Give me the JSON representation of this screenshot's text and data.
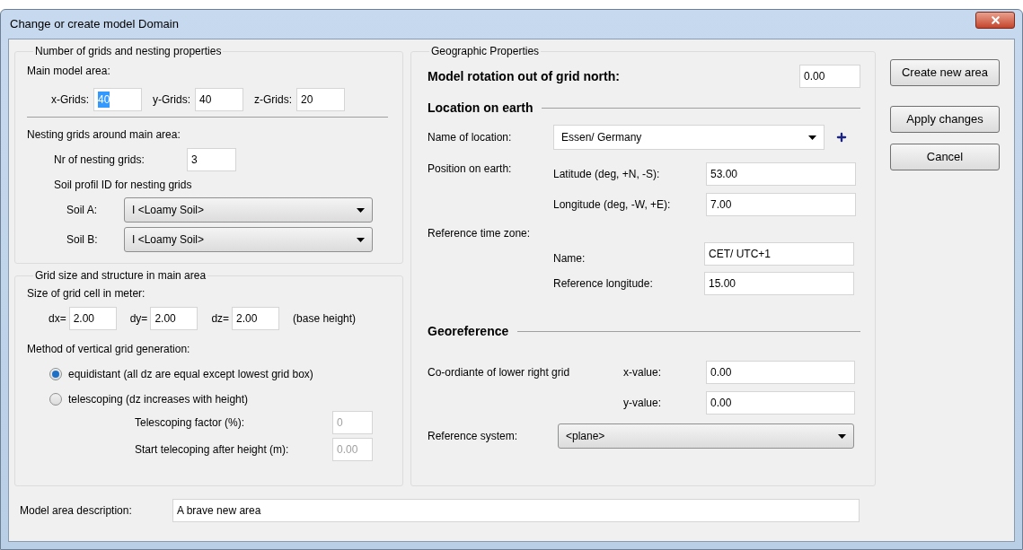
{
  "window": {
    "title": "Change or create model Domain"
  },
  "grids_group": {
    "title": "Number of grids and nesting properties",
    "main_area_label": "Main model area:",
    "grid_fields": [
      {
        "label": "x-Grids:",
        "value": "40",
        "selected": true
      },
      {
        "label": "y-Grids:",
        "value": "40",
        "selected": false
      },
      {
        "label": "z-Grids:",
        "value": "20",
        "selected": false
      }
    ],
    "nesting_label": "Nesting grids around main area:",
    "nesting_count": {
      "label": "Nr of nesting grids:",
      "value": "3"
    },
    "soil_label": "Soil profil ID for nesting grids",
    "soils": [
      {
        "label": "Soil A:",
        "value": "I <Loamy Soil>"
      },
      {
        "label": "Soil B:",
        "value": "I <Loamy Soil>"
      }
    ]
  },
  "structure_group": {
    "title": "Grid size and structure in main area",
    "cell_size_label": "Size of grid cell in meter:",
    "cell_fields": [
      {
        "label": "dx=",
        "value": "2.00"
      },
      {
        "label": "dy=",
        "value": "2.00"
      },
      {
        "label": "dz=",
        "value": "2.00"
      }
    ],
    "cell_note": "(base height)",
    "method_label": "Method of vertical grid generation:",
    "methods": [
      {
        "label": "equidistant (all dz are equal except lowest grid box)",
        "selected": true
      },
      {
        "label": "telescoping (dz increases with height)",
        "selected": false
      }
    ],
    "telescoping_fields": [
      {
        "label": "Telescoping factor (%):",
        "value": "0",
        "disabled": true
      },
      {
        "label": "Start telecoping after height (m):",
        "value": "0.00",
        "disabled": true
      }
    ]
  },
  "geo_group": {
    "title": "Geographic Properties",
    "rotation": {
      "label": "Model rotation out of grid north:",
      "value": "0.00"
    },
    "location_heading": "Location on earth",
    "location": {
      "label": "Name of location:",
      "value": "Essen/ Germany"
    },
    "position_label": "Position on earth:",
    "position_fields": [
      {
        "label": "Latitude (deg, +N, -S):",
        "value": "53.00"
      },
      {
        "label": "Longitude (deg, -W, +E):",
        "value": "7.00"
      }
    ],
    "timezone_label": "Reference time zone:",
    "timezone_fields": [
      {
        "label": "Name:",
        "value": "CET/ UTC+1"
      },
      {
        "label": "Reference longitude:",
        "value": "15.00"
      }
    ],
    "georeference_heading": "Georeference",
    "coordinate_label": "Co-ordiante of lower right grid",
    "coordinate_fields": [
      {
        "label": "x-value:",
        "value": "0.00"
      },
      {
        "label": "y-value:",
        "value": "0.00"
      }
    ],
    "reference_system": {
      "label": "Reference system:",
      "value": "<plane>"
    }
  },
  "buttons": [
    "Create new area",
    "Apply changes",
    "Cancel"
  ],
  "description": {
    "label": "Model area description:",
    "value": "A brave new area"
  }
}
